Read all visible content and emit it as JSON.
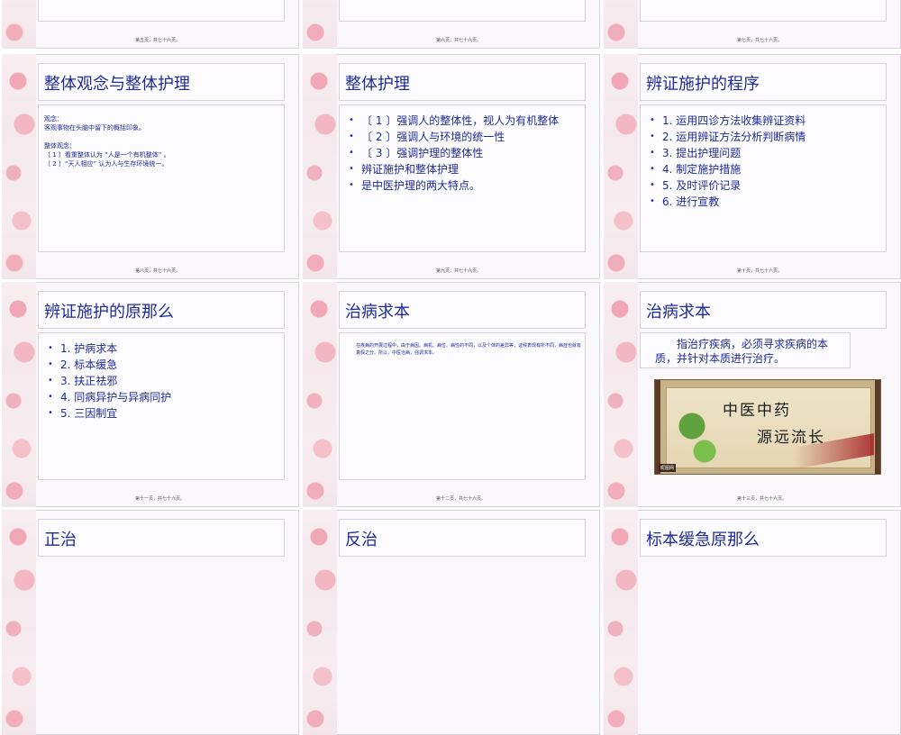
{
  "slides": {
    "s1": {
      "footer": "第五页，共七十六页。"
    },
    "s2": {
      "footer": "第六页，共七十六页。"
    },
    "s3": {
      "footer": "第七页，共七十六页。"
    },
    "s4": {
      "title": "整体观念与整体护理",
      "body": "观念：\n客观事物在头脑中留下的概括印象。\n\n整体观念：\n〔 1 〕看重整体认为 “人是一个有机整体” 。\n〔 2 〕“天人相应” 认为人与生存环境统一。",
      "footer": "第八页，共七十六页。"
    },
    "s5": {
      "title": "整体护理",
      "items": [
        "〔 1 〕强调人的整体性，视人为有机整体",
        "〔 2 〕强调人与环境的统一性",
        "〔 3 〕强调护理的整体性",
        "",
        "辨证施护和整体护理",
        "是中医护理的两大特点。"
      ],
      "footer": "第九页，共七十六页。"
    },
    "s6": {
      "title": "辨证施护的程序",
      "items": [
        "1. 运用四诊方法收集辨证资料",
        "2. 运用辨证方法分析判断病情",
        "3. 提出护理问题",
        "4. 制定施护措施",
        "5. 及时评价记录",
        "6. 进行宣教"
      ],
      "footer": "第十页，共七十六页。"
    },
    "s7": {
      "title": "辨证施护的原那么",
      "items": [
        "1. 护病求本",
        "2. 标本缓急",
        "3. 扶正祛邪",
        "4. 同病异护与异病同护",
        "5. 三因制宜"
      ],
      "footer": "第十一页，共七十六页。"
    },
    "s8": {
      "title": "治病求本",
      "body": "在疾病的开展过程中，由于病因、病机、病位、病性的不同，以及个体的差异等，证候表现有所不同，病症也就有真假之分。所以，中医治病，强调求本。",
      "footer": "第十二页，共七十六页。"
    },
    "s9": {
      "title": "治病求本",
      "body": "指治疗疾病，必须寻求疾病的本质，并针对本质进行治疗。",
      "image_text_line1": "中医中药",
      "image_text_line2": "源远流长",
      "image_credit": "昵图网",
      "footer": "第十三页，共七十六页。"
    },
    "s10": {
      "title": "正治"
    },
    "s11": {
      "title": "反治"
    },
    "s12": {
      "title": "标本缓急原那么"
    }
  }
}
